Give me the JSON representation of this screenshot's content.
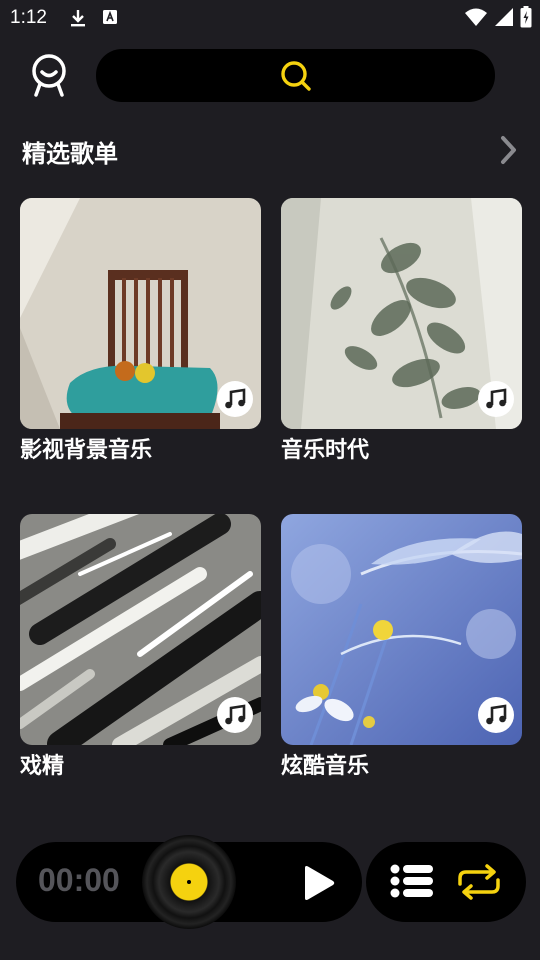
{
  "status_bar": {
    "time": "1:12"
  },
  "header": {
    "avatar_icon": "face-outline-icon",
    "search_icon": "search-icon"
  },
  "section": {
    "title": "精选歌单",
    "more_icon": "chevron-right-icon"
  },
  "playlists": [
    {
      "title": "影视背景音乐",
      "cover": "chair-photo",
      "badge_icon": "music-note-icon"
    },
    {
      "title": "音乐时代",
      "cover": "leaf-shadow-photo",
      "badge_icon": "music-note-icon"
    },
    {
      "title": "戏精",
      "cover": "abstract-paint-photo",
      "badge_icon": "music-note-icon"
    },
    {
      "title": "炫酷音乐",
      "cover": "flower-photo",
      "badge_icon": "music-note-icon"
    }
  ],
  "player": {
    "time": "00:00"
  },
  "colors": {
    "accent": "#f5d20f",
    "background": "#1e1d22",
    "bar": "#000000"
  }
}
